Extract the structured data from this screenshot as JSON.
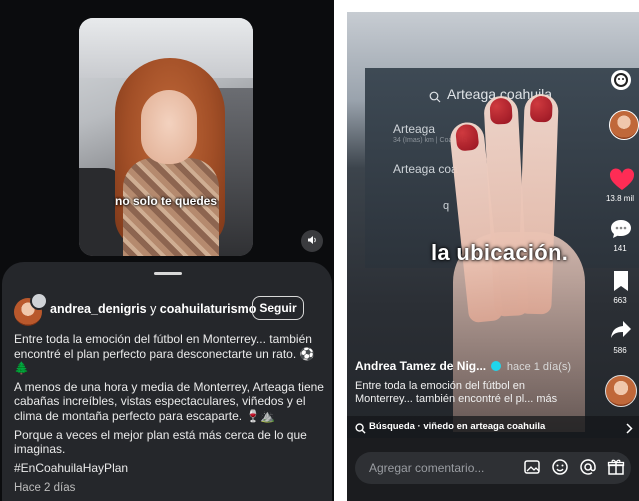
{
  "left_post": {
    "video_caption": "no solo te quedes",
    "author_1": "andrea_denigris",
    "conjunction": "y",
    "author_2": "coahuilaturismo",
    "follow_label": "Seguir",
    "paragraph_1": "Entre toda la emoción del fútbol en Monterrey... también encontré el plan perfecto para desconectarte un rato. ⚽ 🌲",
    "paragraph_2": "A menos de una hora y media de Monterrey, Arteaga tiene cabañas increíbles, vistas espectaculares, viñedos y el clima de montaña perfecto para escaparte. 🍷⛰️",
    "paragraph_3": "Porque a veces el mejor plan está más cerca de lo que imaginas.",
    "hashtag": "#EnCoahuilaHayPlan",
    "timestamp": "Hace 2 días"
  },
  "right_post": {
    "screen_search": "Arteaga coahuila",
    "suggestion_1": "Arteaga",
    "suggestion_1_sub": "34 (Imas) km | Coahuila",
    "suggestion_2": "Arteaga coa",
    "key_q": "q",
    "overlay_text": "la ubicación.",
    "likes": "13.8 mil",
    "comments": "141",
    "saves": "663",
    "shares": "586",
    "creator": "Andrea Tamez de Nig...",
    "time_ago": "hace 1 día(s)",
    "description": "Entre toda la emoción del fútbol en Monterrey... también encontré el pl... más",
    "search_label": "Búsqueda · viñedo en arteaga coahuila",
    "comment_placeholder": "Agregar comentario...",
    "accent_like": "#fe2c55"
  }
}
